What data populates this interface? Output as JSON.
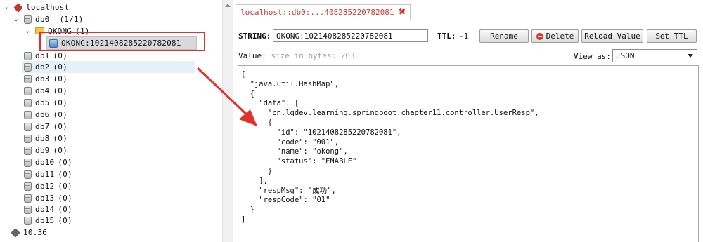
{
  "tree": {
    "server": "localhost",
    "db0": {
      "name": "db0",
      "count": "(1/1)"
    },
    "folder": {
      "name": "OKONG",
      "count": "(1)"
    },
    "key": "OKONG:1021408285220782081",
    "databases": [
      {
        "name": "db1",
        "count": "(0)"
      },
      {
        "name": "db2",
        "count": "(0)"
      },
      {
        "name": "db3",
        "count": "(0)"
      },
      {
        "name": "db4",
        "count": "(0)"
      },
      {
        "name": "db5",
        "count": "(0)"
      },
      {
        "name": "db6",
        "count": "(0)"
      },
      {
        "name": "db7",
        "count": "(0)"
      },
      {
        "name": "db8",
        "count": "(0)"
      },
      {
        "name": "db9",
        "count": "(0)"
      },
      {
        "name": "db10",
        "count": "(0)"
      },
      {
        "name": "db11",
        "count": "(0)"
      },
      {
        "name": "db12",
        "count": "(0)"
      },
      {
        "name": "db13",
        "count": "(0)"
      },
      {
        "name": "db14",
        "count": "(0)"
      },
      {
        "name": "db15",
        "count": "(0)"
      }
    ],
    "other_server": "10.36"
  },
  "tab": {
    "title": "localhost::db0:...408285220782081"
  },
  "key_bar": {
    "type_label": "STRING:",
    "key_value": "OKONG:1021408285220782081",
    "ttl_label": "TTL:",
    "ttl_value": "-1",
    "rename": "Rename",
    "delete": "Delete",
    "reload": "Reload Value",
    "set_ttl": "Set TTL"
  },
  "value_bar": {
    "label": "Value:",
    "hint": "size in bytes: 203",
    "view_as_label": "View as:",
    "view_as_value": "JSON"
  },
  "editor": {
    "lines": [
      "[",
      "  \"java.util.HashMap\",",
      "  {",
      "    \"data\": [",
      "      \"cn.lqdev.learning.springboot.chapter11.controller.UserResp\",",
      "      {",
      "        \"id\": \"1021408285220782081\",",
      "        \"code\": \"001\",",
      "        \"name\": \"okong\",",
      "        \"status\": \"ENABLE\"",
      "      }",
      "    ],",
      "    \"respMsg\": \"成功\",",
      "    \"respCode\": \"01\"",
      "  }",
      "]"
    ]
  },
  "colors": {
    "annotation_red": "#e0312b",
    "tab_text": "#d23a3a",
    "selection": "#e6f0fb"
  }
}
